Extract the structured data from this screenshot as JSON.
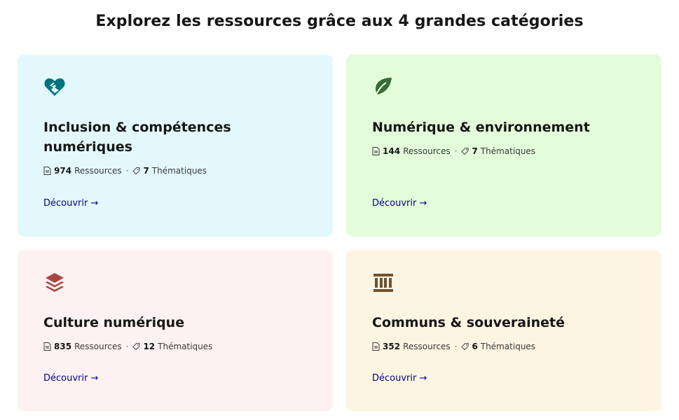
{
  "heading": "Explorez les ressources grâce aux 4 grandes catégories",
  "categories": [
    {
      "title": "Inclusion & compétences numériques",
      "icon": "handshake-heart-icon",
      "icon_color": "#00747c",
      "background": "#e3f8fd",
      "resources_count": "974",
      "resources_label": "Ressources",
      "separator": "·",
      "themes_count": "7",
      "themes_label": "Thématiques",
      "link": "Découvrir →"
    },
    {
      "title": "Numérique & environnement",
      "icon": "leaf-icon",
      "icon_color": "#3b6a3a",
      "background": "#e3fcd9",
      "resources_count": "144",
      "resources_label": "Ressources",
      "separator": "·",
      "themes_count": "7",
      "themes_label": "Thématiques",
      "link": "Découvrir →"
    },
    {
      "title": "Culture numérique",
      "icon": "layers-icon",
      "icon_color": "#a94645",
      "background": "#fdf1f1",
      "resources_count": "835",
      "resources_label": "Ressources",
      "separator": "·",
      "themes_count": "12",
      "themes_label": "Thématiques",
      "link": "Découvrir →"
    },
    {
      "title": "Communs & souveraineté",
      "icon": "government-building-icon",
      "icon_color": "#6e5233",
      "background": "#fdf4e2",
      "resources_count": "352",
      "resources_label": "Ressources",
      "separator": "·",
      "themes_count": "6",
      "themes_label": "Thématiques",
      "link": "Découvrir →"
    }
  ]
}
